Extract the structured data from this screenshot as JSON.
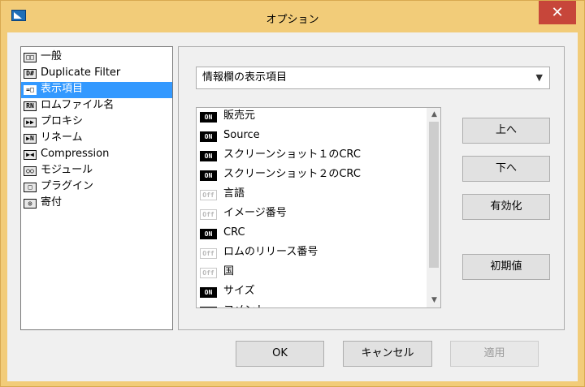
{
  "window": {
    "title": "オプション",
    "close_label": "✕"
  },
  "tree": {
    "items": [
      {
        "label": "一般",
        "icon": "□□"
      },
      {
        "label": "Duplicate Filter",
        "icon": "D#"
      },
      {
        "label": "表示項目",
        "icon": "=□",
        "selected": true
      },
      {
        "label": "ロムファイル名",
        "icon": "RN"
      },
      {
        "label": "プロキシ",
        "icon": "▶▶"
      },
      {
        "label": "リネーム",
        "icon": "▶N"
      },
      {
        "label": "Compression",
        "icon": "▶◀"
      },
      {
        "label": "モジュール",
        "icon": "○○"
      },
      {
        "label": "プラグイン",
        "icon": "□"
      },
      {
        "label": "寄付",
        "icon": "◎"
      }
    ]
  },
  "combo": {
    "value": "情報欄の表示項目"
  },
  "list": {
    "items": [
      {
        "label": "販売元",
        "state": "ON"
      },
      {
        "label": "Source",
        "state": "ON"
      },
      {
        "label": "スクリーンショット１のCRC",
        "state": "ON"
      },
      {
        "label": "スクリーンショット２のCRC",
        "state": "ON"
      },
      {
        "label": "言語",
        "state": "Off"
      },
      {
        "label": "イメージ番号",
        "state": "Off"
      },
      {
        "label": "CRC",
        "state": "ON"
      },
      {
        "label": "ロムのリリース番号",
        "state": "Off"
      },
      {
        "label": "国",
        "state": "Off"
      },
      {
        "label": "サイズ",
        "state": "ON"
      },
      {
        "label": "コメント",
        "state": "ON"
      }
    ]
  },
  "buttons": {
    "up": "上へ",
    "down": "下へ",
    "enable": "有効化",
    "reset": "初期値",
    "ok": "OK",
    "cancel": "キャンセル",
    "apply": "適用"
  },
  "colors": {
    "frame": "#f2cc79",
    "close": "#c7463a",
    "selection": "#3399ff"
  }
}
